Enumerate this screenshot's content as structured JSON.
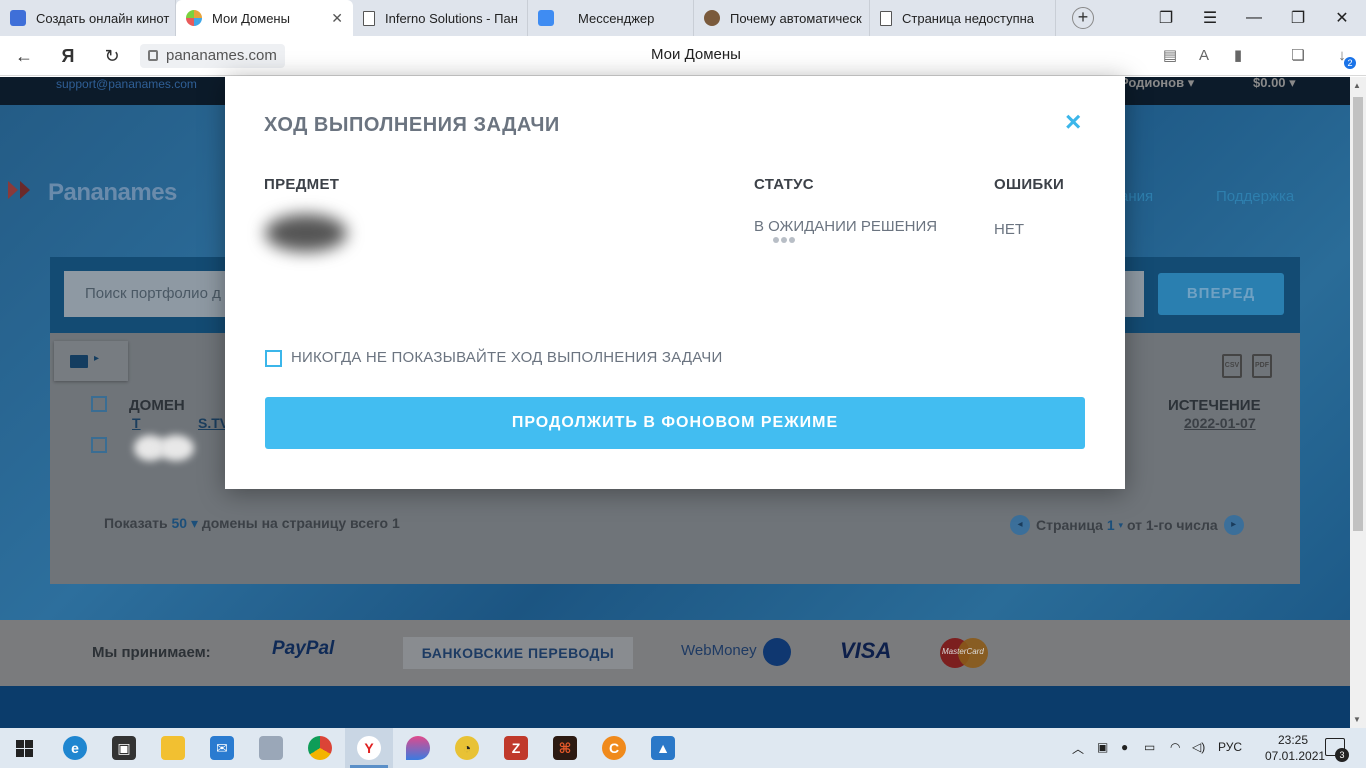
{
  "browser": {
    "tabs": [
      {
        "title": "Создать онлайн кинот",
        "active": false,
        "favicon_color": "#3f6fd8"
      },
      {
        "title": "Мои Домены",
        "active": true,
        "favicon_color": "#e8a33a"
      },
      {
        "title": "Inferno Solutions - Пан",
        "active": false,
        "favicon_color": "#ffffff"
      },
      {
        "title": "Мессенджер",
        "active": false,
        "favicon_color": "#3f8cf2"
      },
      {
        "title": "Почему автоматическ",
        "active": false,
        "favicon_color": "#7a5a3c"
      },
      {
        "title": "Страница недоступна",
        "active": false,
        "favicon_color": "#ffffff"
      }
    ],
    "new_tab": "+",
    "url": "pananames.com",
    "page_title": "Мои Домены",
    "downloads_count": "2"
  },
  "site": {
    "support_email": "support@pananames.com",
    "user_name": "Родионов",
    "balance": "$0.00",
    "logo_text": "Pananames",
    "nav": [
      "ания",
      "Поддержка"
    ],
    "search": {
      "placeholder": "Поиск портфолио д",
      "button": "ВПЕРЕД"
    },
    "table": {
      "col_domain": "ДОМЕН",
      "col_expiry": "ИСТЕЧЕНИЕ",
      "row": {
        "domain_tail": "S.TV",
        "domain_head": "T",
        "expiry": "2022-01-07"
      }
    },
    "pager": {
      "show": "Показать",
      "per_page": "50",
      "per_page_suffix": "домены на страницу всего 1",
      "page_label": "Страница",
      "page_num": "1",
      "of_label": "от 1-го числа"
    },
    "footer": {
      "we_accept": "Мы принимаем:",
      "paypal": "PayPal",
      "bank": "БАНКОВСКИЕ ПЕРЕВОДЫ",
      "webmoney": "WebMoney",
      "visa": "VISA",
      "mastercard": "MasterCard"
    }
  },
  "modal": {
    "title": "ХОД ВЫПОЛНЕНИЯ ЗАДАЧИ",
    "close": "×",
    "col_subject": "ПРЕДМЕТ",
    "col_status": "СТАТУС",
    "col_errors": "ОШИБКИ",
    "status_value": "В ОЖИДАНИИ РЕШЕНИЯ",
    "errors_value": "НЕТ",
    "checkbox_label": "НИКОГДА НЕ ПОКАЗЫВАЙТЕ ХОД ВЫПОЛНЕНИЯ ЗАДАЧИ",
    "checkbox_checked": false,
    "button": "ПРОДОЛЖИТЬ В ФОНОВОМ РЕЖИМЕ",
    "accent_color": "#42bdf1"
  },
  "taskbar": {
    "lang": "РУС",
    "time": "23:25",
    "date": "07.01.2021",
    "notifications": "3"
  }
}
